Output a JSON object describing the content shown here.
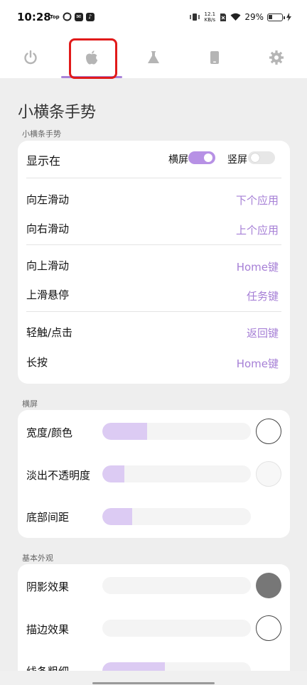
{
  "status_bar": {
    "time": "10:28",
    "left_icons": [
      "top-app-icon",
      "sync-icon",
      "mail-icon",
      "tiktok-icon"
    ],
    "top_tag": "Top",
    "net_speed_value": "12.1",
    "net_speed_unit": "KB/s",
    "battery": "29%",
    "right_icons": [
      "vibrate-icon",
      "netspeed-icon",
      "sim-icon",
      "wifi-icon",
      "battery-icon",
      "charging-icon"
    ]
  },
  "tabs": [
    {
      "icon": "power-icon",
      "selected": false
    },
    {
      "icon": "apple-icon",
      "selected": true
    },
    {
      "icon": "flask-icon",
      "selected": false
    },
    {
      "icon": "phone-icon",
      "selected": false
    },
    {
      "icon": "gear-icon",
      "selected": false
    }
  ],
  "colors": {
    "accent": "#a67fd6",
    "highlight_box": "#e11a1a"
  },
  "page": {
    "title": "小横条手势"
  },
  "gesture_section": {
    "label": "小横条手势",
    "show_on": {
      "label": "显示在",
      "landscape": {
        "label": "横屏",
        "on": true
      },
      "portrait": {
        "label": "竖屏",
        "on": false
      }
    },
    "rows": [
      {
        "label": "向左滑动",
        "value": "下个应用"
      },
      {
        "label": "向右滑动",
        "value": "上个应用"
      },
      {
        "label": "向上滑动",
        "value": "Home键"
      },
      {
        "label": "上滑悬停",
        "value": "任务键"
      },
      {
        "label": "轻触/点击",
        "value": "返回键"
      },
      {
        "label": "长按",
        "value": "Home键"
      }
    ]
  },
  "landscape_section": {
    "label": "横屏",
    "rows": [
      {
        "label": "宽度/颜色",
        "level": 0.3,
        "swatch": "#ffffff"
      },
      {
        "label": "淡出不透明度",
        "level": 0.15,
        "swatch": "#f7f7f7"
      },
      {
        "label": "底部间距",
        "level": 0.2
      }
    ]
  },
  "appearance_section": {
    "label": "基本外观",
    "rows": [
      {
        "label": "阴影效果",
        "level": 0,
        "swatch": "#777777"
      },
      {
        "label": "描边效果",
        "level": 0,
        "swatch": "#ffffff"
      },
      {
        "label": "线条粗细",
        "level": 0.42
      }
    ]
  }
}
